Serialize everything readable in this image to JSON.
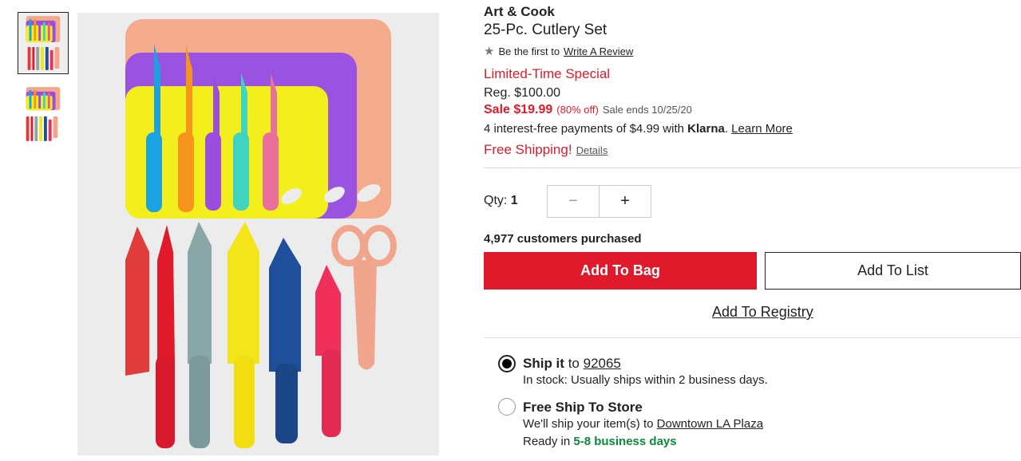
{
  "product": {
    "brand": "Art & Cook",
    "title": "25-Pc. Cutlery Set"
  },
  "review": {
    "prefix": "Be the first to",
    "link": "Write A Review",
    "icon": "star-icon"
  },
  "pricing": {
    "special": "Limited-Time Special",
    "regular": "Reg. $100.00",
    "sale": "Sale $19.99",
    "discount": "(80% off)",
    "sale_ends": "Sale ends 10/25/20"
  },
  "klarna": {
    "text": "4 interest-free payments of $4.99 with",
    "brand": "Klarna",
    "link": "Learn More"
  },
  "shipping_promo": {
    "label": "Free Shipping!",
    "details": "Details"
  },
  "quantity": {
    "label": "Qty:",
    "value": "1",
    "minus": "−",
    "plus": "+"
  },
  "purchased": "4,977 customers purchased",
  "buttons": {
    "add_to_bag": "Add To Bag",
    "add_to_list": "Add To List",
    "add_to_registry": "Add To Registry"
  },
  "fulfillment": {
    "ship": {
      "title": "Ship it",
      "to": "to",
      "zip": "92065",
      "note": "In stock: Usually ships within 2 business days.",
      "selected": true
    },
    "store": {
      "title": "Free Ship To Store",
      "note_prefix": "We'll ship your item(s) to",
      "store_name": "Downtown LA Plaza",
      "ready_prefix": "Ready in",
      "ready_days": "5-8 business days",
      "selected": false
    }
  },
  "colors": {
    "accent_red": "#e11a2b",
    "ready_green": "#0a8a3a"
  }
}
